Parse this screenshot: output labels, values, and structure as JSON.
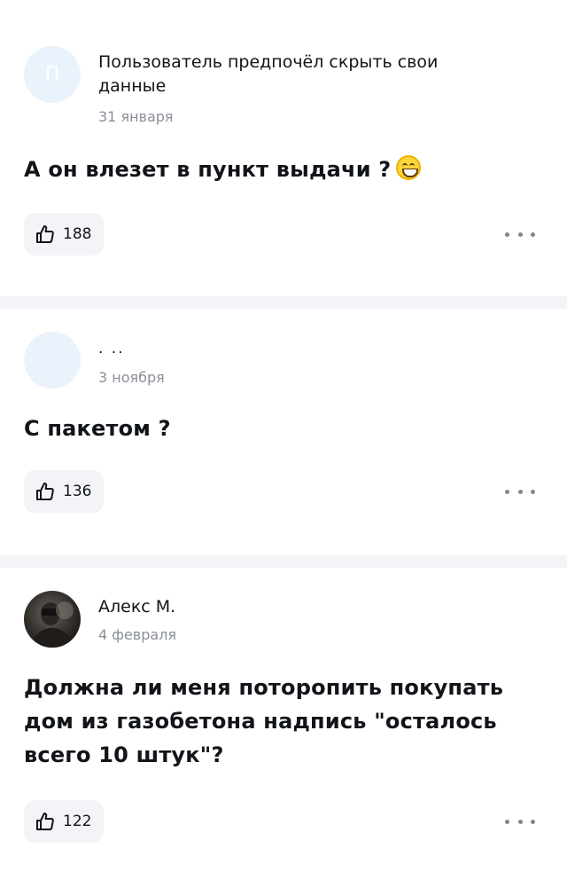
{
  "comments": [
    {
      "avatar_letter": "П",
      "author": "Пользователь предпочёл скрыть свои данные",
      "date": "31 января",
      "text": "А он влезет в пункт выдачи ?",
      "emoji_icon": "grinning-face-icon",
      "likes": "188"
    },
    {
      "avatar_letter": ".",
      "author": ". ..",
      "date": "3 ноября",
      "text": "С пакетом ?",
      "likes": "136"
    },
    {
      "author": "Алекс М.",
      "date": "4 февраля",
      "text": "Должна ли меня поторопить покупать дом из газобетона надпись \"осталось всего 10 штук\"?",
      "likes": "122"
    }
  ],
  "colors": {
    "divider": "#f2f4f7",
    "avatar_placeholder": "#eaf3fb",
    "secondary_text": "#8a8f98",
    "like_button_bg": "#f2f4f7"
  }
}
